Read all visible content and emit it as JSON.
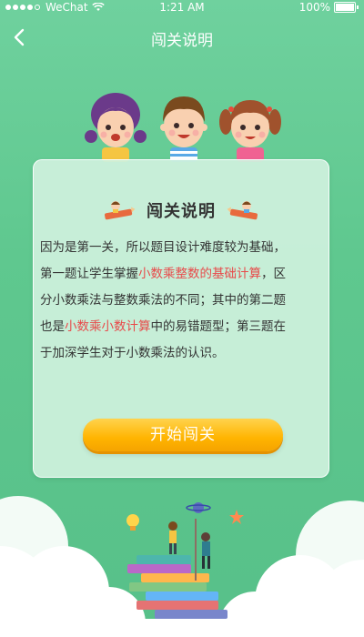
{
  "status_bar": {
    "carrier": "WeChat",
    "time": "1:21 AM",
    "battery": "100%"
  },
  "nav": {
    "title": "闯关说明",
    "back_icon": "chevron-left-icon"
  },
  "card": {
    "title": "闯关说明",
    "desc_parts": [
      "因为是第一关，所以题目设计难度较为基础，第一题让学生掌握",
      "小数乘整数的基础计算",
      "，区分小数乘法与整数乘法的不同；其中的第二题也是",
      "小数乘小数计算",
      "中的易错题型；第三题在于加深学生对于小数乘法的认识。"
    ],
    "start_button": "开始闯关"
  },
  "colors": {
    "background": "#5fc88f",
    "highlight": "#e84a4a",
    "button": "#ffb400"
  }
}
